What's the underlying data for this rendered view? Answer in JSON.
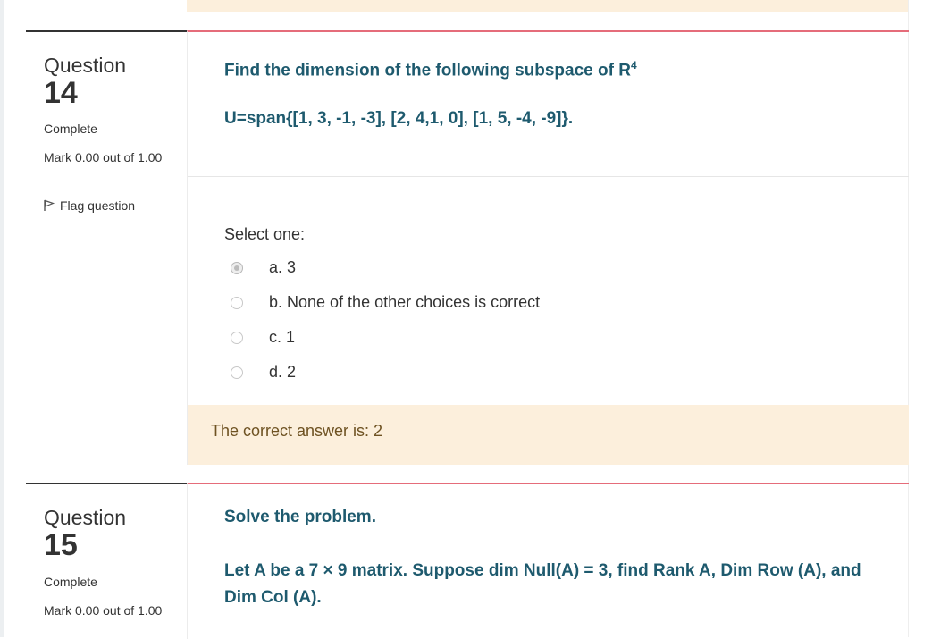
{
  "q14": {
    "label": "Question",
    "number": "14",
    "state": "Complete",
    "grade": "Mark 0.00 out of 1.00",
    "flag": "Flag question",
    "text_line1": "Find the dimension of the following subspace of R",
    "text_sup": "4",
    "text_line2": "U=span{[1, 3, -1, -3], [2, 4,1, 0], [1, 5, -4, -9]}.",
    "prompt": "Select one:",
    "options": [
      {
        "label": "a. 3",
        "checked": true
      },
      {
        "label": "b. None of the other choices is correct",
        "checked": false
      },
      {
        "label": "c. 1",
        "checked": false
      },
      {
        "label": "d. 2",
        "checked": false
      }
    ],
    "right_answer": "The correct answer is: 2"
  },
  "q15": {
    "label": "Question",
    "number": "15",
    "state": "Complete",
    "grade": "Mark 0.00 out of 1.00",
    "text_line1": "Solve the problem.",
    "text_line2": "Let A be a 7 × 9 matrix. Suppose dim Null(A) = 3, find Rank A, Dim Row (A), and",
    "text_line3": "Dim Col (A)."
  },
  "icons": {
    "flag": "flag-icon"
  },
  "colors": {
    "accent_red": "#e56c7a",
    "question_text": "#1e5a6e",
    "feedback_bg": "#fcefdc",
    "feedback_text": "#6e5222"
  }
}
